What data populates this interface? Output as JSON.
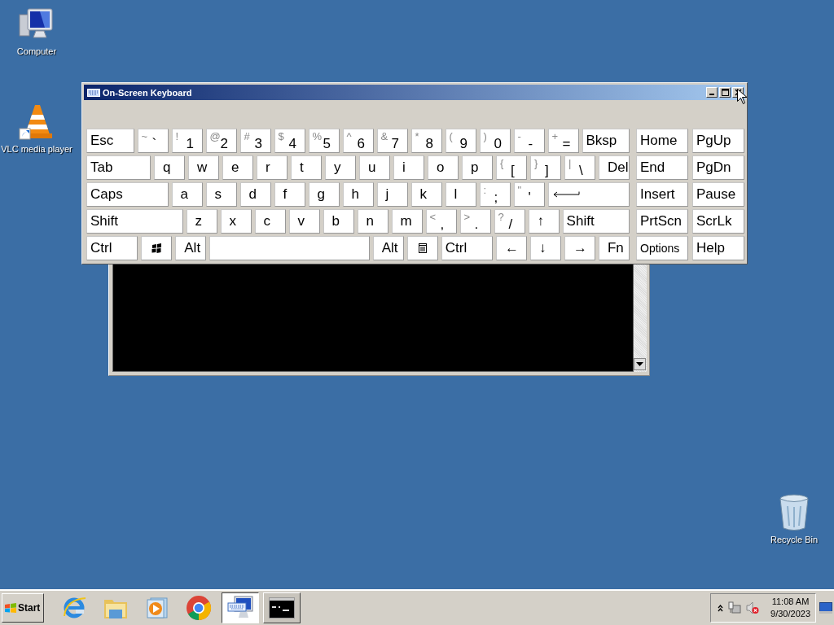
{
  "desktop_icons": [
    {
      "kind": "computer",
      "label": "Computer"
    },
    {
      "kind": "vlc",
      "label": "VLC media player"
    },
    {
      "kind": "recycle_bin",
      "label": "Recycle Bin"
    }
  ],
  "keyboard": {
    "title": "On-Screen Keyboard",
    "main_rows": [
      [
        {
          "kind": "wide",
          "label": "Esc"
        },
        {
          "kind": "dual",
          "shift": "~",
          "label": "`"
        },
        {
          "kind": "dual",
          "shift": "!",
          "label": "1"
        },
        {
          "kind": "dual",
          "shift": "@",
          "label": "2"
        },
        {
          "kind": "dual",
          "shift": "#",
          "label": "3"
        },
        {
          "kind": "dual",
          "shift": "$",
          "label": "4"
        },
        {
          "kind": "dual",
          "shift": "%",
          "label": "5"
        },
        {
          "kind": "dual",
          "shift": "^",
          "label": "6"
        },
        {
          "kind": "dual",
          "shift": "&",
          "label": "7"
        },
        {
          "kind": "dual",
          "shift": "*",
          "label": "8"
        },
        {
          "kind": "dual",
          "shift": "(",
          "label": "9"
        },
        {
          "kind": "dual",
          "shift": ")",
          "label": "0"
        },
        {
          "kind": "dual",
          "shift": "-",
          "label": "-"
        },
        {
          "kind": "dual",
          "shift": "+",
          "label": "="
        },
        {
          "kind": "wide",
          "label": "Bksp"
        }
      ],
      [
        {
          "kind": "wide",
          "label": "Tab"
        },
        {
          "kind": "char",
          "label": "q"
        },
        {
          "kind": "char",
          "label": "w"
        },
        {
          "kind": "char",
          "label": "e"
        },
        {
          "kind": "char",
          "label": "r"
        },
        {
          "kind": "char",
          "label": "t"
        },
        {
          "kind": "char",
          "label": "y"
        },
        {
          "kind": "char",
          "label": "u"
        },
        {
          "kind": "char",
          "label": "i"
        },
        {
          "kind": "char",
          "label": "o"
        },
        {
          "kind": "char",
          "label": "p"
        },
        {
          "kind": "dual",
          "shift": "{",
          "label": "["
        },
        {
          "kind": "dual",
          "shift": "}",
          "label": "]"
        },
        {
          "kind": "dual",
          "shift": "|",
          "label": "\\"
        },
        {
          "kind": "char",
          "label": "Del"
        }
      ],
      [
        {
          "kind": "wide",
          "label": "Caps"
        },
        {
          "kind": "char",
          "label": "a"
        },
        {
          "kind": "char",
          "label": "s"
        },
        {
          "kind": "char",
          "label": "d"
        },
        {
          "kind": "char",
          "label": "f"
        },
        {
          "kind": "char",
          "label": "g"
        },
        {
          "kind": "char",
          "label": "h"
        },
        {
          "kind": "char",
          "label": "j"
        },
        {
          "kind": "char",
          "label": "k"
        },
        {
          "kind": "char",
          "label": "l"
        },
        {
          "kind": "dual",
          "shift": ":",
          "label": ";"
        },
        {
          "kind": "dual",
          "shift": "\"",
          "label": "'"
        },
        {
          "kind": "enter"
        }
      ],
      [
        {
          "kind": "widest",
          "label": "Shift"
        },
        {
          "kind": "char",
          "label": "z"
        },
        {
          "kind": "char",
          "label": "x"
        },
        {
          "kind": "char",
          "label": "c"
        },
        {
          "kind": "char",
          "label": "v"
        },
        {
          "kind": "char",
          "label": "b"
        },
        {
          "kind": "char",
          "label": "n"
        },
        {
          "kind": "char",
          "label": "m"
        },
        {
          "kind": "dual",
          "shift": "<",
          "label": ","
        },
        {
          "kind": "dual",
          "shift": ">",
          "label": "."
        },
        {
          "kind": "dual",
          "shift": "?",
          "label": "/"
        },
        {
          "kind": "char",
          "label": "↑"
        },
        {
          "kind": "wide",
          "label": "Shift"
        }
      ],
      [
        {
          "kind": "wide",
          "label": "Ctrl"
        },
        {
          "kind": "windows"
        },
        {
          "kind": "char",
          "label": "Alt"
        },
        {
          "kind": "space"
        },
        {
          "kind": "char",
          "label": "Alt"
        },
        {
          "kind": "menu"
        },
        {
          "kind": "wide",
          "label": "Ctrl"
        },
        {
          "kind": "char",
          "label": "←"
        },
        {
          "kind": "char",
          "label": "↓"
        },
        {
          "kind": "char",
          "label": "→"
        },
        {
          "kind": "char",
          "label": "Fn"
        }
      ]
    ],
    "nav_keys": [
      {
        "kind": "nav",
        "label": "Home"
      },
      {
        "kind": "nav",
        "label": "PgUp"
      },
      {
        "kind": "nav",
        "label": "End"
      },
      {
        "kind": "nav",
        "label": "PgDn"
      },
      {
        "kind": "nav",
        "label": "Insert"
      },
      {
        "kind": "nav",
        "label": "Pause"
      },
      {
        "kind": "nav",
        "label": "PrtScn"
      },
      {
        "kind": "nav",
        "label": "ScrLk"
      },
      {
        "kind": "small",
        "label": "Options"
      },
      {
        "kind": "nav",
        "label": "Help"
      }
    ]
  },
  "taskbar": {
    "start": "Start",
    "buttons": [
      {
        "kind": "ie",
        "selected": false
      },
      {
        "kind": "folder",
        "selected": false
      },
      {
        "kind": "media",
        "selected": false
      },
      {
        "kind": "chrome",
        "selected": false
      },
      {
        "kind": "osk",
        "selected": true
      },
      {
        "kind": "cmd",
        "selected": false
      }
    ],
    "time": "11:08 AM",
    "date": "9/30/2023"
  }
}
